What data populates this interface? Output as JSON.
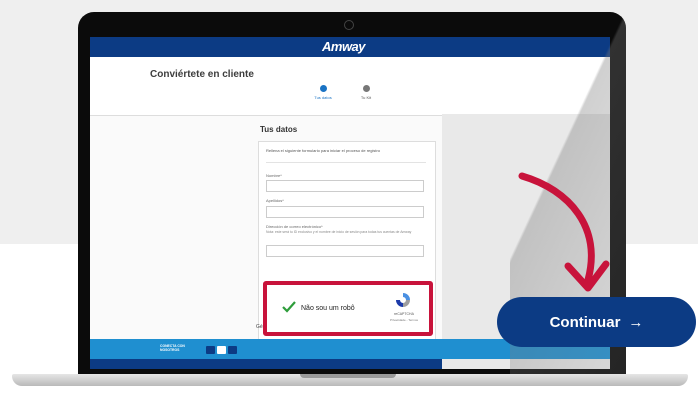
{
  "brand": {
    "logo_text": "Amway"
  },
  "page": {
    "title": "Conviértete en cliente",
    "steps": [
      {
        "label": "Tus datos"
      },
      {
        "label": "Tu Kit"
      }
    ]
  },
  "form": {
    "section_title": "Tus datos",
    "intro": "Rellena el siguiente formulario para iniciar el proceso de registro",
    "fields": [
      {
        "label": "Nombre*",
        "value": ""
      },
      {
        "label": "Apellidos*",
        "value": ""
      },
      {
        "label": "Dirección de correo electrónico*",
        "note": "Nota: este será tu ID exclusivo y el nombre de inicio de sesión para todas tus cuentas de Amway",
        "value": ""
      }
    ],
    "gender_label": "Gén"
  },
  "recaptcha": {
    "label": "Não sou um robô",
    "brand": "reCAPTCHA",
    "terms": "Privacidade - Termos"
  },
  "footer": {
    "connect_text": "CONECTA CON NOSOTROS"
  },
  "cta": {
    "label": "Continuar",
    "arrow": "→"
  },
  "colors": {
    "nav_blue": "#0c3b84",
    "footer_blue": "#1f8fd0",
    "highlight_red": "#c8133b",
    "step_active": "#1a73c4"
  },
  "icons": [
    "youtube-icon",
    "facebook-icon",
    "instagram-icon",
    "checkmark-icon",
    "recaptcha-icon",
    "curved-arrow-icon",
    "arrow-right-icon"
  ]
}
